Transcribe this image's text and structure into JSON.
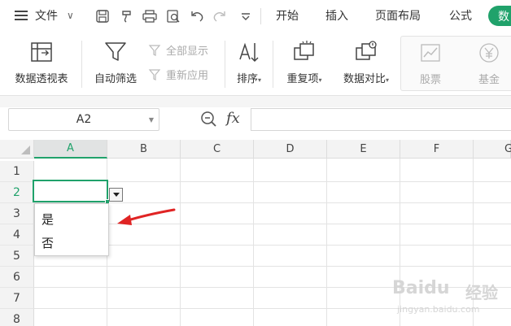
{
  "menubar": {
    "file_label": "文件",
    "tabs": [
      "开始",
      "插入",
      "页面布局",
      "公式"
    ],
    "active_tab": "数",
    "active_color": "#20a26b"
  },
  "ribbon": {
    "pivot": "数据透视表",
    "autofilter": "自动筛选",
    "show_all": "全部显示",
    "reapply": "重新应用",
    "sort": "排序",
    "duplicates": "重复项",
    "compare": "数据对比",
    "stocks": "股票",
    "funds": "基金"
  },
  "formula_bar": {
    "name_box": "A2",
    "fx": "fx",
    "formula": ""
  },
  "grid": {
    "columns": [
      "A",
      "B",
      "C",
      "D",
      "E",
      "F",
      "G"
    ],
    "rows": [
      "1",
      "2",
      "3",
      "4",
      "5",
      "6",
      "7",
      "8"
    ],
    "selected_column": "A",
    "selected_row": "2"
  },
  "dropdown": {
    "options": [
      "是",
      "否"
    ]
  },
  "watermark": {
    "brand": "Baidu",
    "brand_cn": "经验",
    "url": "jingyan.baidu.com"
  },
  "icons": {
    "hamburger": "hamburger-icon",
    "save": "save-icon",
    "format_painter": "format-painter-icon",
    "print": "print-icon",
    "print_preview": "print-preview-icon",
    "undo": "undo-icon",
    "redo": "redo-icon",
    "more": "more-icon",
    "arrow_color": "#e02424"
  }
}
